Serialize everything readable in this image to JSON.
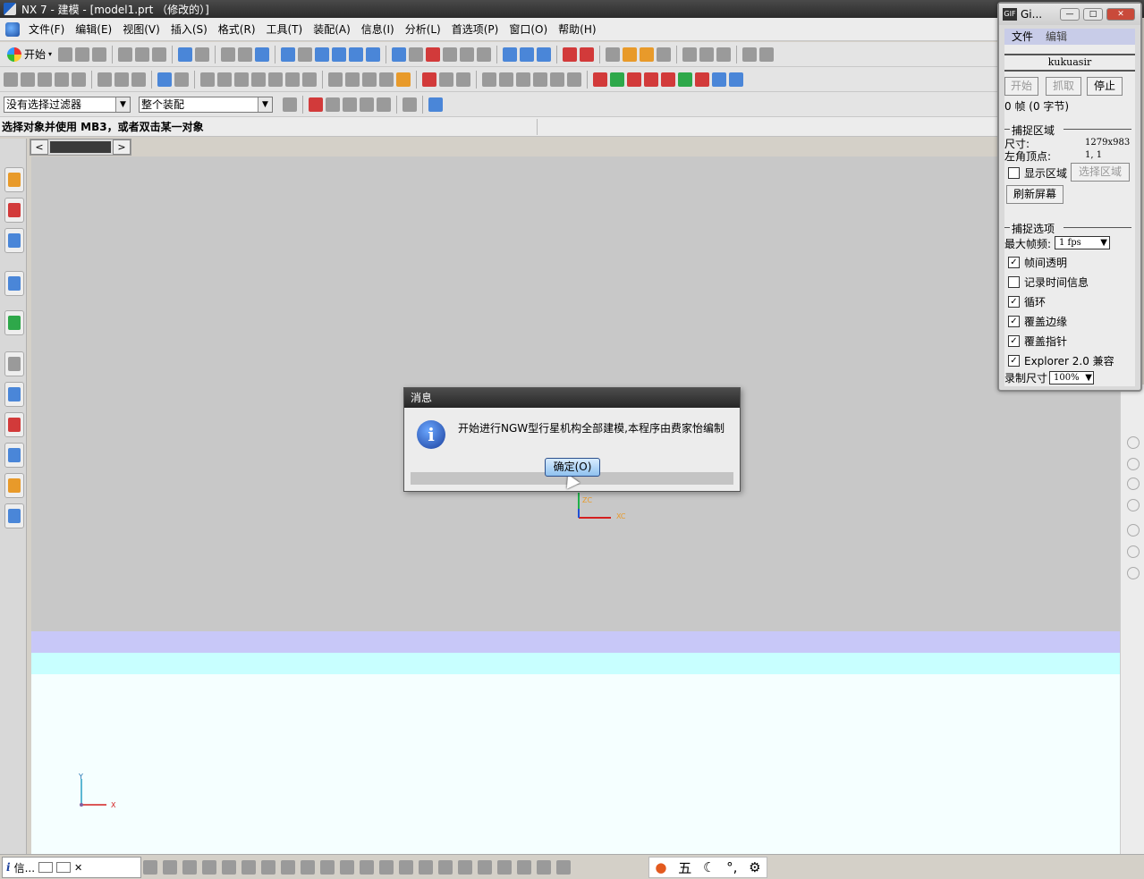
{
  "window": {
    "title": "NX 7 - 建模 - [model1.prt （修改的）]"
  },
  "menu": {
    "items": [
      "文件(F)",
      "编辑(E)",
      "视图(V)",
      "插入(S)",
      "格式(R)",
      "工具(T)",
      "装配(A)",
      "信息(I)",
      "分析(L)",
      "首选项(P)",
      "窗口(O)",
      "帮助(H)"
    ]
  },
  "toolbar": {
    "start_label": "开始"
  },
  "filters": {
    "selection_filter": "没有选择过滤器",
    "assembly_scope": "整个装配"
  },
  "cue_line": {
    "text": "选择对象并使用 MB3，或者双击某一对象"
  },
  "axes": {
    "wcs_z": "ZC",
    "wcs_x": "XC",
    "abs_y": "Y",
    "abs_x": "X"
  },
  "dialog": {
    "title": "消息",
    "message": "开始进行NGW型行星机构全部建模,本程序由费家怡编制",
    "ok_label": "确定(O)"
  },
  "statusbar": {
    "info_tab_label": "信...",
    "ime_char": "五"
  },
  "recorder": {
    "title": "Gi...",
    "menu": [
      "文件",
      "编辑"
    ],
    "name": "kukuasir",
    "buttons": {
      "start": "开始",
      "capture": "抓取",
      "stop": "停止"
    },
    "frames_text": "0 帧 (0 字节)",
    "capture_area_heading": "捕捉区域",
    "size_label": "尺寸:",
    "size_value": "1279x983",
    "corner_label": "左角顶点:",
    "corner_value": "1, 1",
    "show_area_label": "显示区域",
    "select_area_label": "选择区域",
    "refresh_label": "刷新屏幕",
    "options_heading": "捕捉选项",
    "max_fps_label": "最大帧频:",
    "max_fps_value": "1 fps",
    "options": [
      {
        "label": "帧间透明",
        "checked": true
      },
      {
        "label": "记录时间信息",
        "checked": false
      },
      {
        "label": "循环",
        "checked": true
      },
      {
        "label": "覆盖边缘",
        "checked": true
      },
      {
        "label": "覆盖指针",
        "checked": true
      },
      {
        "label": "Explorer 2.0 兼容",
        "checked": true
      }
    ],
    "record_size_label": "录制尺寸",
    "record_size_value": "100%"
  }
}
